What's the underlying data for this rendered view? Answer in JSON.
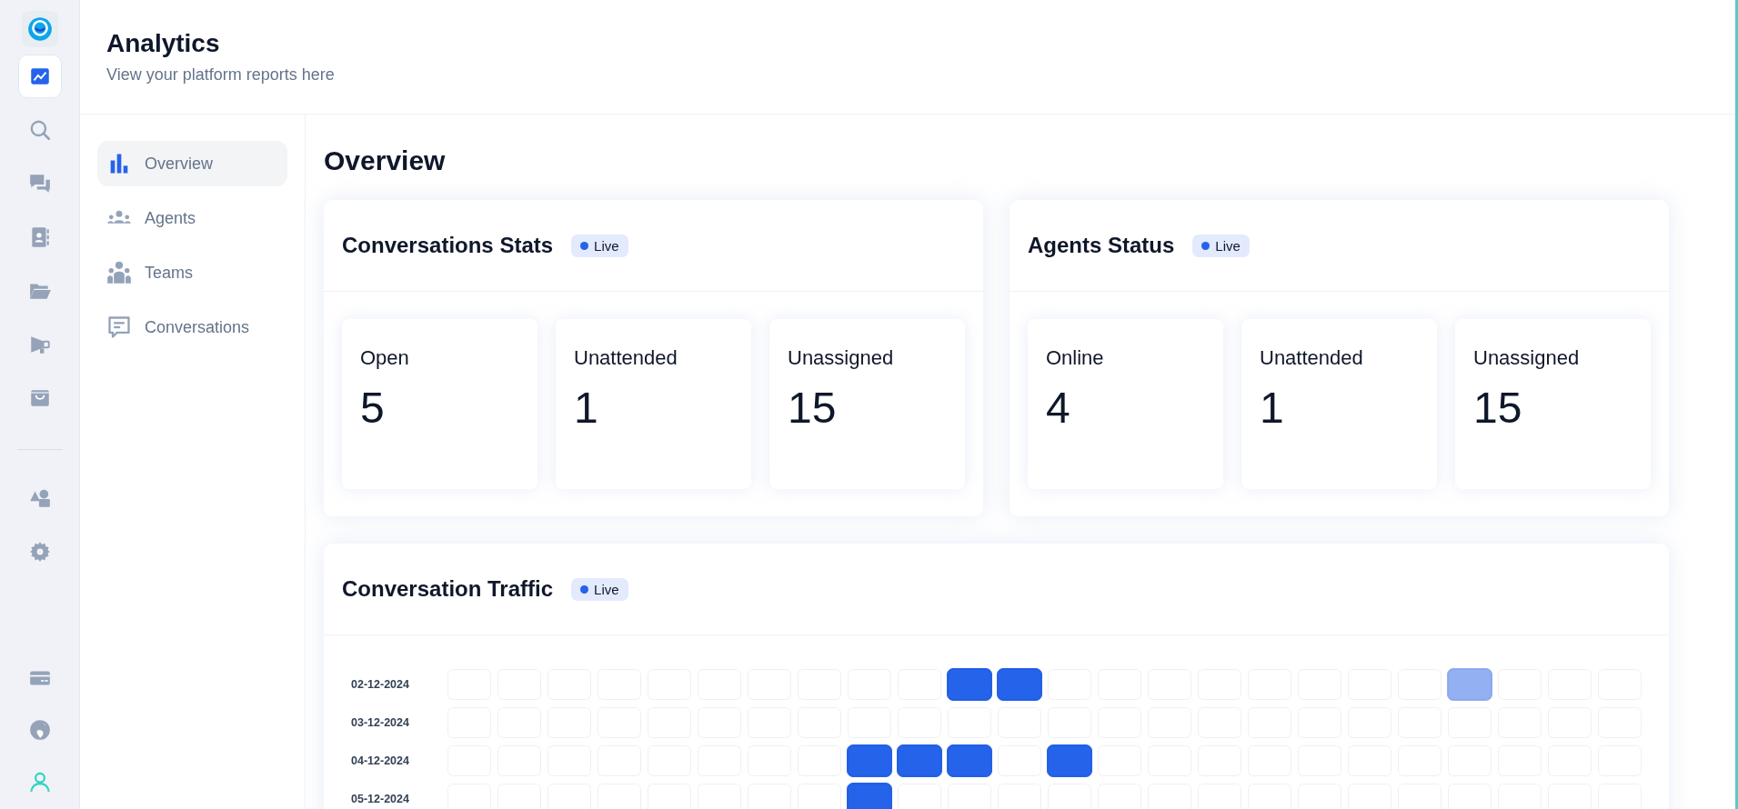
{
  "rail": {
    "top": [
      {
        "kind": "chart",
        "selected": true
      },
      {
        "kind": "search",
        "selected": false
      },
      {
        "kind": "chat",
        "selected": false
      },
      {
        "kind": "contacts",
        "selected": false
      },
      {
        "kind": "folder",
        "selected": false
      },
      {
        "kind": "megaphone",
        "selected": false
      },
      {
        "kind": "inbox",
        "selected": false
      }
    ],
    "middle": [
      {
        "kind": "shapes",
        "selected": false
      },
      {
        "kind": "settings",
        "selected": false
      }
    ],
    "bottom": [
      {
        "kind": "card",
        "selected": false
      },
      {
        "kind": "globe",
        "selected": false
      },
      {
        "kind": "user",
        "selected": false
      }
    ]
  },
  "header": {
    "title": "Analytics",
    "subtitle": "View your platform reports here"
  },
  "nav": [
    {
      "label": "Overview",
      "kind": "bars",
      "selected": true
    },
    {
      "label": "Agents",
      "kind": "agents",
      "selected": false
    },
    {
      "label": "Teams",
      "kind": "teams",
      "selected": false
    },
    {
      "label": "Conversations",
      "kind": "conversations",
      "selected": false
    }
  ],
  "page_title": "Overview",
  "panels": [
    {
      "title": "Conversations Stats",
      "badge": "Live",
      "stats": [
        {
          "label": "Open",
          "value": "5"
        },
        {
          "label": "Unattended",
          "value": "1"
        },
        {
          "label": "Unassigned",
          "value": "15"
        }
      ]
    },
    {
      "title": "Agents Status",
      "badge": "Live",
      "stats": [
        {
          "label": "Online",
          "value": "4"
        },
        {
          "label": "Unattended",
          "value": "1"
        },
        {
          "label": "Unassigned",
          "value": "15"
        }
      ]
    }
  ],
  "traffic": {
    "title": "Conversation Traffic",
    "badge": "Live",
    "rows": [
      {
        "date": "02-12-2024",
        "cells": [
          {
            "color": "#ffffff"
          },
          {
            "color": "#ffffff"
          },
          {
            "color": "#ffffff"
          },
          {
            "color": "#ffffff"
          },
          {
            "color": "#ffffff"
          },
          {
            "color": "#ffffff"
          },
          {
            "color": "#ffffff"
          },
          {
            "color": "#ffffff"
          },
          {
            "color": "#ffffff"
          },
          {
            "color": "#ffffff"
          },
          {
            "color": "#2563eb"
          },
          {
            "color": "#2563eb"
          },
          {
            "color": "#ffffff"
          },
          {
            "color": "#ffffff"
          },
          {
            "color": "#ffffff"
          },
          {
            "color": "#ffffff"
          },
          {
            "color": "#ffffff"
          },
          {
            "color": "#ffffff"
          },
          {
            "color": "#ffffff"
          },
          {
            "color": "#ffffff"
          },
          {
            "color": "#93b0f3"
          },
          {
            "color": "#ffffff"
          },
          {
            "color": "#ffffff"
          },
          {
            "color": "#ffffff"
          }
        ]
      },
      {
        "date": "03-12-2024",
        "cells": [
          {
            "color": "#ffffff"
          },
          {
            "color": "#ffffff"
          },
          {
            "color": "#ffffff"
          },
          {
            "color": "#ffffff"
          },
          {
            "color": "#ffffff"
          },
          {
            "color": "#ffffff"
          },
          {
            "color": "#ffffff"
          },
          {
            "color": "#ffffff"
          },
          {
            "color": "#ffffff"
          },
          {
            "color": "#ffffff"
          },
          {
            "color": "#ffffff"
          },
          {
            "color": "#ffffff"
          },
          {
            "color": "#ffffff"
          },
          {
            "color": "#ffffff"
          },
          {
            "color": "#ffffff"
          },
          {
            "color": "#ffffff"
          },
          {
            "color": "#ffffff"
          },
          {
            "color": "#ffffff"
          },
          {
            "color": "#ffffff"
          },
          {
            "color": "#ffffff"
          },
          {
            "color": "#ffffff"
          },
          {
            "color": "#ffffff"
          },
          {
            "color": "#ffffff"
          },
          {
            "color": "#ffffff"
          }
        ]
      },
      {
        "date": "04-12-2024",
        "cells": [
          {
            "color": "#ffffff"
          },
          {
            "color": "#ffffff"
          },
          {
            "color": "#ffffff"
          },
          {
            "color": "#ffffff"
          },
          {
            "color": "#ffffff"
          },
          {
            "color": "#ffffff"
          },
          {
            "color": "#ffffff"
          },
          {
            "color": "#ffffff"
          },
          {
            "color": "#2563eb"
          },
          {
            "color": "#2563eb"
          },
          {
            "color": "#2563eb"
          },
          {
            "color": "#ffffff"
          },
          {
            "color": "#2563eb"
          },
          {
            "color": "#ffffff"
          },
          {
            "color": "#ffffff"
          },
          {
            "color": "#ffffff"
          },
          {
            "color": "#ffffff"
          },
          {
            "color": "#ffffff"
          },
          {
            "color": "#ffffff"
          },
          {
            "color": "#ffffff"
          },
          {
            "color": "#ffffff"
          },
          {
            "color": "#ffffff"
          },
          {
            "color": "#ffffff"
          },
          {
            "color": "#ffffff"
          }
        ]
      },
      {
        "date": "05-12-2024",
        "cells": [
          {
            "color": "#ffffff"
          },
          {
            "color": "#ffffff"
          },
          {
            "color": "#ffffff"
          },
          {
            "color": "#ffffff"
          },
          {
            "color": "#ffffff"
          },
          {
            "color": "#ffffff"
          },
          {
            "color": "#ffffff"
          },
          {
            "color": "#ffffff"
          },
          {
            "color": "#2563eb"
          },
          {
            "color": "#ffffff"
          },
          {
            "color": "#ffffff"
          },
          {
            "color": "#ffffff"
          },
          {
            "color": "#ffffff"
          },
          {
            "color": "#ffffff"
          },
          {
            "color": "#ffffff"
          },
          {
            "color": "#ffffff"
          },
          {
            "color": "#ffffff"
          },
          {
            "color": "#ffffff"
          },
          {
            "color": "#ffffff"
          },
          {
            "color": "#ffffff"
          },
          {
            "color": "#ffffff"
          },
          {
            "color": "#ffffff"
          },
          {
            "color": "#ffffff"
          },
          {
            "color": "#ffffff"
          }
        ]
      }
    ]
  }
}
